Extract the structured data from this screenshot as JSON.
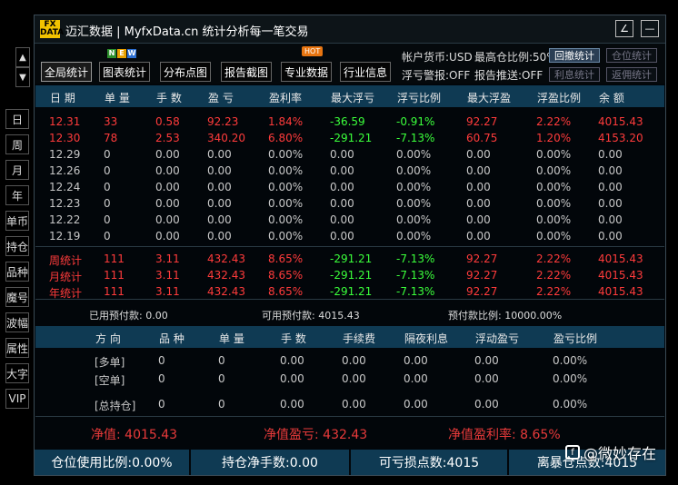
{
  "app": {
    "logo_text": "FX DATA",
    "title": "迈汇数据 | MyfxData.cn  统计分析每一笔交易"
  },
  "title_buttons": {
    "edit_glyph": "∠",
    "minimize_glyph": "—"
  },
  "sidebar": {
    "up_glyph": "▲",
    "down_glyph": "▼",
    "items": [
      "日",
      "周",
      "月",
      "年",
      "单币",
      "持仓",
      "品种",
      "魔号",
      "波幅",
      "属性",
      "大字",
      "VIP"
    ]
  },
  "toolbar": {
    "tabs": [
      "全局统计",
      "图表统计",
      "分布点图",
      "报告截图",
      "专业数据",
      "行业信息"
    ],
    "new_badge": [
      "N",
      "E",
      "W"
    ],
    "hot_badge": "HOT",
    "account_currency": "帐户货币:USD",
    "margin_ratio": "最高仓比例:50%",
    "float_alarm": "浮亏警报:OFF",
    "report_push": "报告推送:OFF",
    "buttons": [
      "回撤统计",
      "仓位统计",
      "利息统计",
      "返佣统计"
    ]
  },
  "table": {
    "headers": [
      "日 期",
      "单 量",
      "手 数",
      "盈 亏",
      "盈利率",
      "最大浮亏",
      "浮亏比例",
      "最大浮盈",
      "浮盈比例",
      "余 额"
    ],
    "rows": [
      [
        "12.31",
        "33",
        "0.58",
        "92.23",
        "1.84%",
        "-36.59",
        "-0.91%",
        "92.27",
        "2.22%",
        "4015.43"
      ],
      [
        "12.30",
        "78",
        "2.53",
        "340.20",
        "6.80%",
        "-291.21",
        "-7.13%",
        "60.75",
        "1.20%",
        "4153.20"
      ],
      [
        "12.29",
        "0",
        "0.00",
        "0.00",
        "0.00%",
        "0.00",
        "0.00%",
        "0.00",
        "0.00%",
        "0.00"
      ],
      [
        "12.26",
        "0",
        "0.00",
        "0.00",
        "0.00%",
        "0.00",
        "0.00%",
        "0.00",
        "0.00%",
        "0.00"
      ],
      [
        "12.24",
        "0",
        "0.00",
        "0.00",
        "0.00%",
        "0.00",
        "0.00%",
        "0.00",
        "0.00%",
        "0.00"
      ],
      [
        "12.23",
        "0",
        "0.00",
        "0.00",
        "0.00%",
        "0.00",
        "0.00%",
        "0.00",
        "0.00%",
        "0.00"
      ],
      [
        "12.22",
        "0",
        "0.00",
        "0.00",
        "0.00%",
        "0.00",
        "0.00%",
        "0.00",
        "0.00%",
        "0.00"
      ],
      [
        "12.19",
        "0",
        "0.00",
        "0.00",
        "0.00%",
        "0.00",
        "0.00%",
        "0.00",
        "0.00%",
        "0.00"
      ]
    ],
    "summary": [
      [
        "周统计",
        "111",
        "3.11",
        "432.43",
        "8.65%",
        "-291.21",
        "-7.13%",
        "92.27",
        "2.22%",
        "4015.43"
      ],
      [
        "月统计",
        "111",
        "3.11",
        "432.43",
        "8.65%",
        "-291.21",
        "-7.13%",
        "92.27",
        "2.22%",
        "4015.43"
      ],
      [
        "年统计",
        "111",
        "3.11",
        "432.43",
        "8.65%",
        "-291.21",
        "-7.13%",
        "92.27",
        "2.22%",
        "4015.43"
      ]
    ]
  },
  "margin_info": {
    "used": "已用预付款:  0.00",
    "available": "可用预付款:  4015.43",
    "ratio": "预付款比例:  10000.00%"
  },
  "positions": {
    "headers": [
      "方 向",
      "品 种",
      "单 量",
      "手 数",
      "手续费",
      "隔夜利息",
      "浮动盈亏",
      "盈亏比例"
    ],
    "rows": [
      [
        "[多单]",
        "0",
        "0",
        "0.00",
        "0.00",
        "0.00",
        "0.00",
        "0.00%"
      ],
      [
        "[空单]",
        "0",
        "0",
        "0.00",
        "0.00",
        "0.00",
        "0.00",
        "0.00%"
      ],
      [
        "[总持仓]",
        "0",
        "0",
        "0.00",
        "0.00",
        "0.00",
        "0.00",
        "0.00%"
      ]
    ]
  },
  "footer": {
    "net_value": "净值:  4015.43",
    "net_profit": "净值盈亏:  432.43",
    "net_rate": "净值盈利率:  8.65%"
  },
  "status": [
    "仓位使用比例:0.00%",
    "持仓净手数:0.00",
    "可亏损点数:4015",
    "离暴仓点数:4015"
  ],
  "watermark": {
    "icon": "f",
    "text": "@微妙存在"
  },
  "colors": {
    "header_bg": "#0f3a53",
    "profit_red": "#ff3b3b",
    "loss_green": "#3bff3b",
    "logo_yellow": "#f2c300"
  }
}
